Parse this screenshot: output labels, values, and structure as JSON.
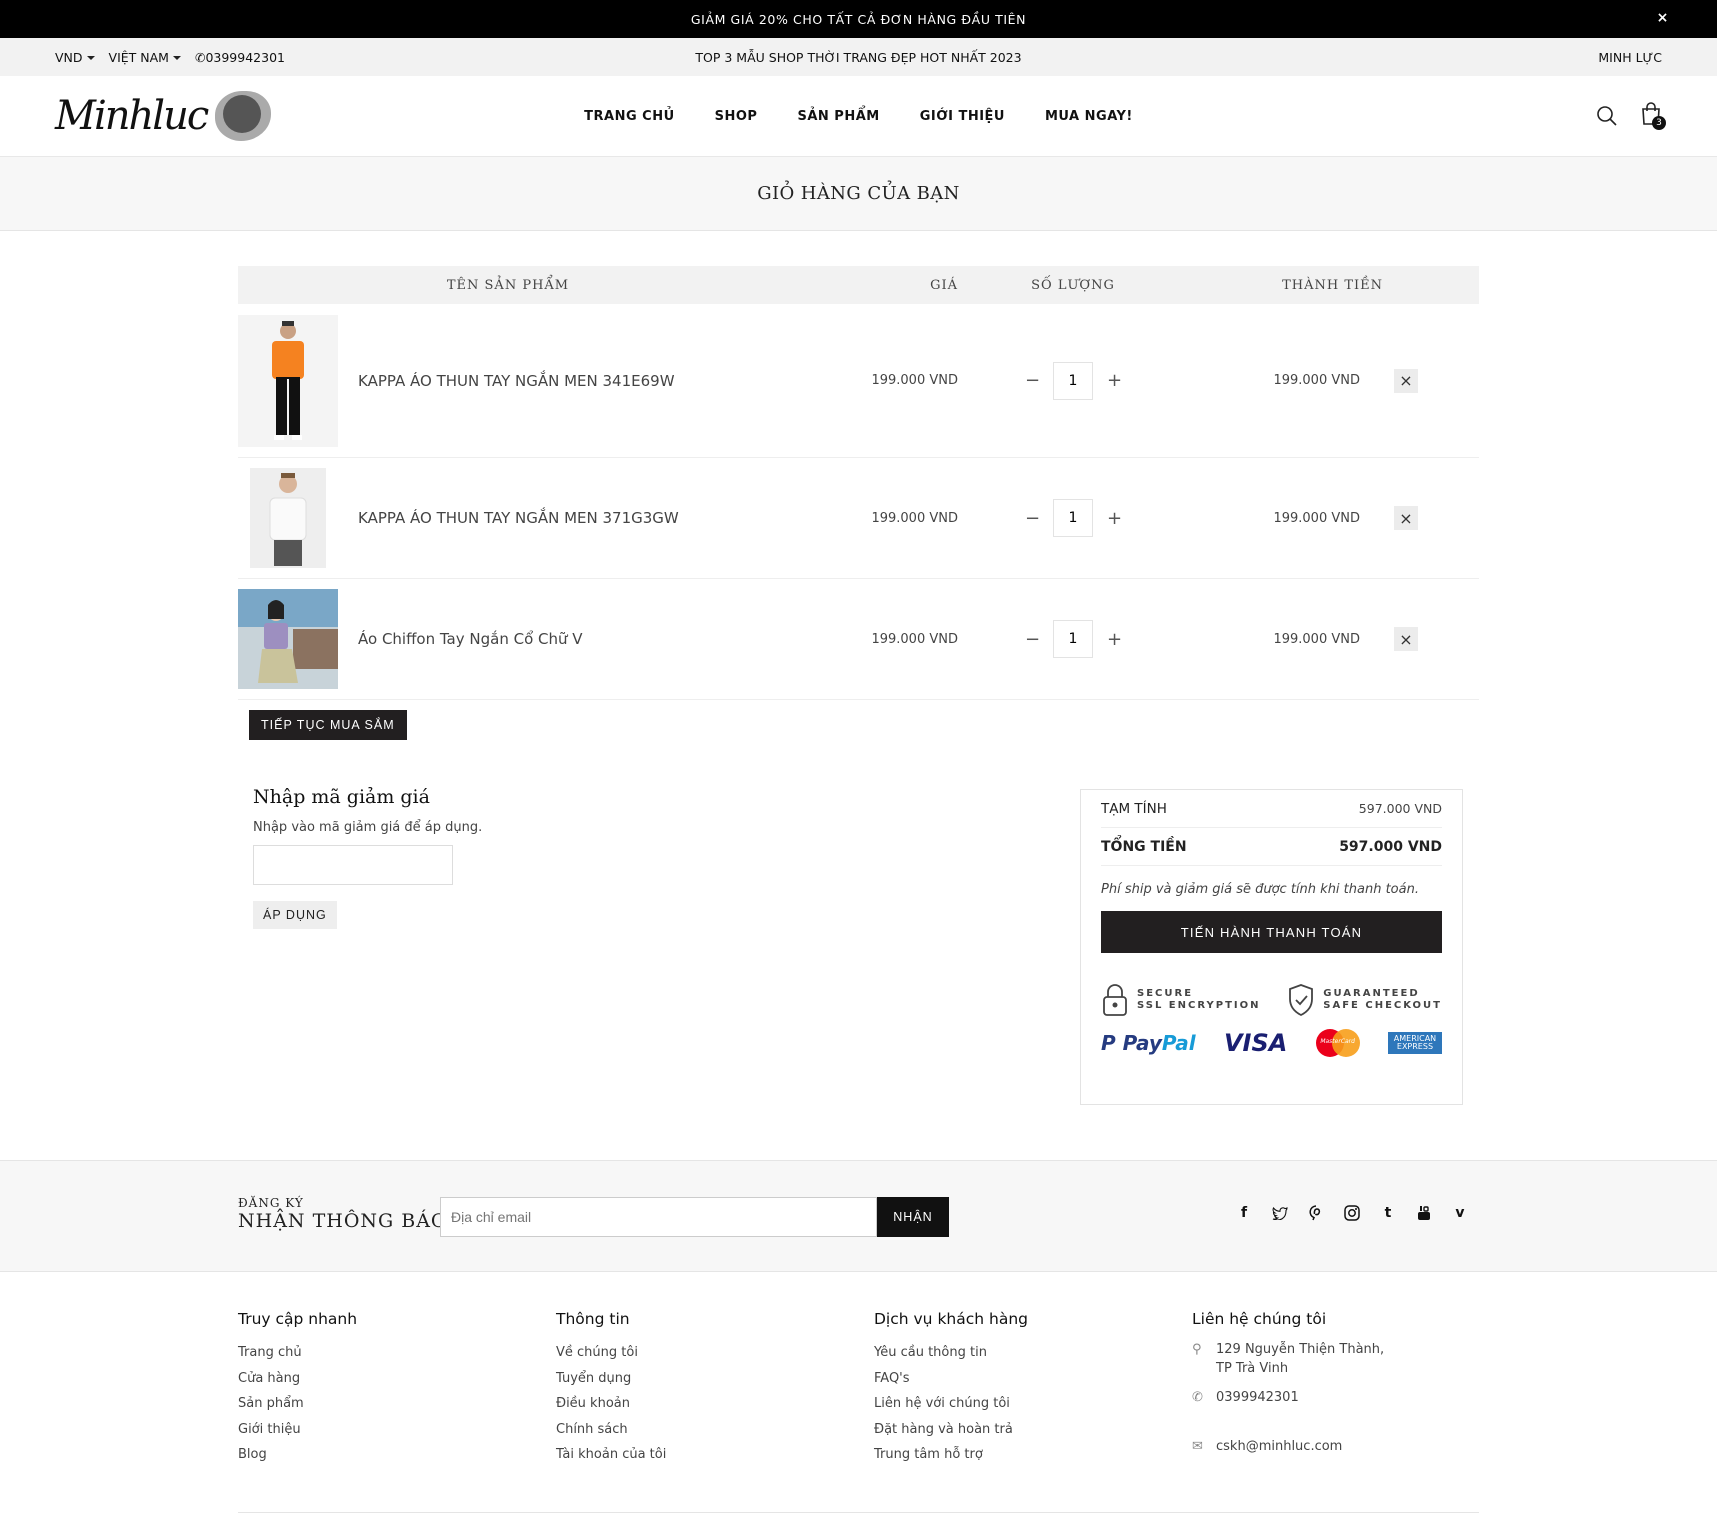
{
  "announcement": {
    "text": "GIẢM GIÁ 20% CHO TẤT CẢ ĐƠN HÀNG ĐẦU TIÊN",
    "close": "×"
  },
  "subbar": {
    "currency": "VND",
    "country": "VIỆT NAM",
    "phone": "0399942301",
    "headline": "TOP 3 MẪU SHOP THỜI TRANG ĐẸP HOT NHẤT 2023",
    "account": "MINH LỰC"
  },
  "header": {
    "logo": "Minhluc",
    "nav": [
      "TRANG CHỦ",
      "SHOP",
      "SẢN PHẨM",
      "GIỚI THIỆU",
      "MUA NGAY!"
    ],
    "cart_count": "3"
  },
  "page_title": "GIỎ HÀNG CỦA BẠN",
  "cart": {
    "headers": {
      "name": "TÊN SẢN PHẨM",
      "price": "GIÁ",
      "qty": "SỐ LƯỢNG",
      "total": "THÀNH TIỀN"
    },
    "items": [
      {
        "name": "KAPPA ÁO THUN TAY NGẮN MEN 341E69W",
        "price": "199.000 VND",
        "qty": "1",
        "total": "199.000 VND"
      },
      {
        "name": "KAPPA ÁO THUN TAY NGẮN MEN 371G3GW",
        "price": "199.000 VND",
        "qty": "1",
        "total": "199.000 VND"
      },
      {
        "name": "Áo Chiffon Tay Ngắn Cổ Chữ V",
        "price": "199.000 VND",
        "qty": "1",
        "total": "199.000 VND"
      }
    ],
    "continue": "TIẾP TỤC MUA SẮM"
  },
  "coupon": {
    "title": "Nhập mã giảm giá",
    "desc": "Nhập vào mã giảm giá để áp dụng.",
    "value": "",
    "apply": "ÁP DỤNG"
  },
  "summary": {
    "subtotal_label": "TẠM TÍNH",
    "subtotal": "597.000 VND",
    "total_label": "TỔNG TIỀN",
    "total": "597.000 VND",
    "note": "Phí ship và giảm giá sẽ được tính khi thanh toán.",
    "checkout": "TIẾN HÀNH THANH TOÁN",
    "secure1a": "SECURE",
    "secure1b": "SSL ENCRYPTION",
    "secure2a": "GUARANTEED",
    "secure2b": "SAFE CHECKOUT",
    "pay1a": "Pay",
    "pay1b": "Pal",
    "pay2": "VISA",
    "pay3": "MasterCard",
    "pay4a": "AMERICAN",
    "pay4b": "EXPRESS"
  },
  "newsletter": {
    "small": "ĐĂNG KÝ",
    "big": "NHẬN THÔNG BÁO",
    "placeholder": "Địa chỉ email",
    "button": "NHẬN"
  },
  "social_icons": [
    "facebook-icon",
    "twitter-icon",
    "pinterest-icon",
    "instagram-icon",
    "tumblr-icon",
    "youtube-icon",
    "vimeo-icon"
  ],
  "footer": {
    "col1": {
      "title": "Truy cập nhanh",
      "links": [
        "Trang chủ",
        "Cửa hàng",
        "Sản phẩm",
        "Giới thiệu",
        "Blog"
      ]
    },
    "col2": {
      "title": "Thông tin",
      "links": [
        "Về chúng tôi",
        "Tuyển dụng",
        "Điều khoản",
        "Chính sách",
        "Tài khoản của tôi"
      ]
    },
    "col3": {
      "title": "Dịch vụ khách hàng",
      "links": [
        "Yêu cầu thông tin",
        "FAQ's",
        "Liên hệ với chúng tôi",
        "Đặt hàng và hoàn trả",
        "Trung tâm hỗ trợ"
      ]
    },
    "col4": {
      "title": "Liên hệ chúng tôi",
      "address1": "129 Nguyễn Thiện Thành,",
      "address2": "TP Trà Vinh",
      "phone": "0399942301",
      "email": "cskh@minhluc.com"
    }
  },
  "colors": {
    "dark": "#221f20",
    "accent_orange": "#f58220"
  }
}
